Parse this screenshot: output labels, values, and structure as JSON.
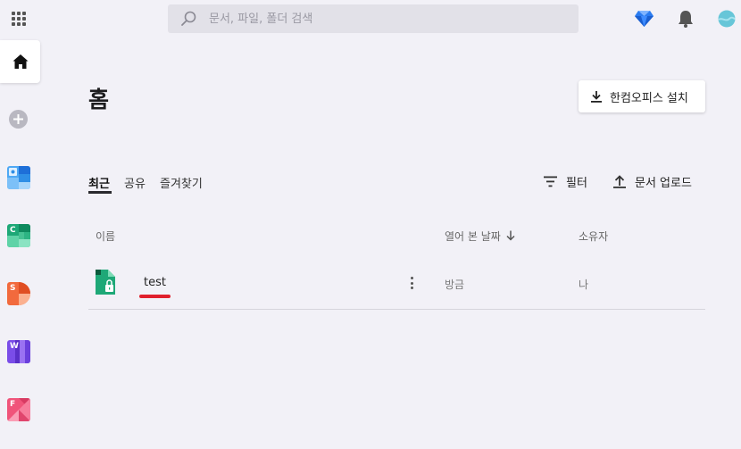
{
  "topbar": {
    "search_placeholder": "문서, 파일, 폴더 검색",
    "apps_icon": "apps-grid-icon",
    "premium_icon": "diamond-icon",
    "notifications_icon": "bell-icon",
    "avatar_icon": "avatar-icon"
  },
  "sidebar": {
    "items": [
      {
        "name": "home",
        "icon": "home-icon"
      },
      {
        "name": "add",
        "icon": "plus-icon"
      },
      {
        "name": "calendar",
        "letter": "",
        "color": "#2f8fe6"
      },
      {
        "name": "cell",
        "letter": "C",
        "color": "#1ea877"
      },
      {
        "name": "show",
        "letter": "S",
        "color": "#f26a3d"
      },
      {
        "name": "word",
        "letter": "W",
        "color": "#7a4de8"
      },
      {
        "name": "form",
        "letter": "F",
        "color": "#f0547a"
      }
    ]
  },
  "main": {
    "title": "홈",
    "install_button": "한컴오피스 설치",
    "tabs": [
      {
        "label": "최근",
        "active": true
      },
      {
        "label": "공유",
        "active": false
      },
      {
        "label": "즐겨찾기",
        "active": false
      }
    ],
    "actions": {
      "filter": "필터",
      "upload": "문서 업로드"
    },
    "table": {
      "columns": {
        "name": "이름",
        "opened_date": "열어 본 날짜",
        "owner": "소유자"
      },
      "rows": [
        {
          "name": "test",
          "opened": "방금",
          "owner": "나",
          "icon": "locked-spreadsheet-icon"
        }
      ]
    }
  },
  "colors": {
    "background": "#f2f1f7",
    "accent_red": "#e0202d",
    "cell_green": "#1ea877"
  }
}
